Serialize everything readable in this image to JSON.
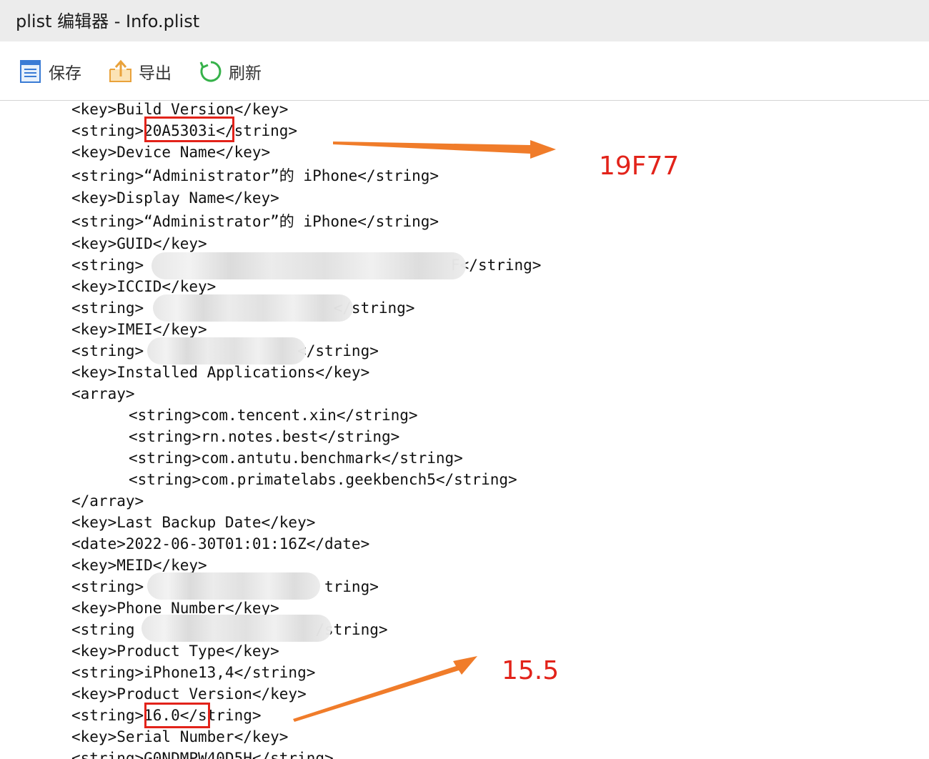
{
  "window": {
    "title": "plist 编辑器 - Info.plist"
  },
  "toolbar": {
    "save_label": "保存",
    "export_label": "导出",
    "refresh_label": "刷新"
  },
  "editor": {
    "lines": [
      "<key>Build Version</key>",
      "<string>20A5303i</string>",
      "<key>Device Name</key>",
      "<string>“Administrator”的 iPhone</string>",
      "<key>Display Name</key>",
      "<string>“Administrator”的 iPhone</string>",
      "<key>GUID</key>",
      "<string>                                  F</string>",
      "<key>ICCID</key>",
      "<string>                     </string>",
      "<key>IMEI</key>",
      "<string>                 </string>",
      "<key>Installed Applications</key>",
      "<array>",
      "<string>com.tencent.xin</string>",
      "<string>rn.notes.best</string>",
      "<string>com.antutu.benchmark</string>",
      "<string>com.primatelabs.geekbench5</string>",
      "</array>",
      "<key>Last Backup Date</key>",
      "<date>2022-06-30T01:01:16Z</date>",
      "<key>MEID</key>",
      "<string>                    tring>",
      "<key>Phone Number</key>",
      "<string                    /string>",
      "<key>Product Type</key>",
      "<string>iPhone13,4</string>",
      "<key>Product Version</key>",
      "<string>16.0</string>",
      "<key>Serial Number</key>",
      "<string>G0NDMPW40D5H</string>"
    ]
  },
  "annotations": {
    "build_version_note": "19F77",
    "product_version_note": "15.5"
  },
  "colors": {
    "annotation_red": "#e2231a",
    "arrow_orange": "#f07c2a",
    "titlebar": "#ececec"
  }
}
